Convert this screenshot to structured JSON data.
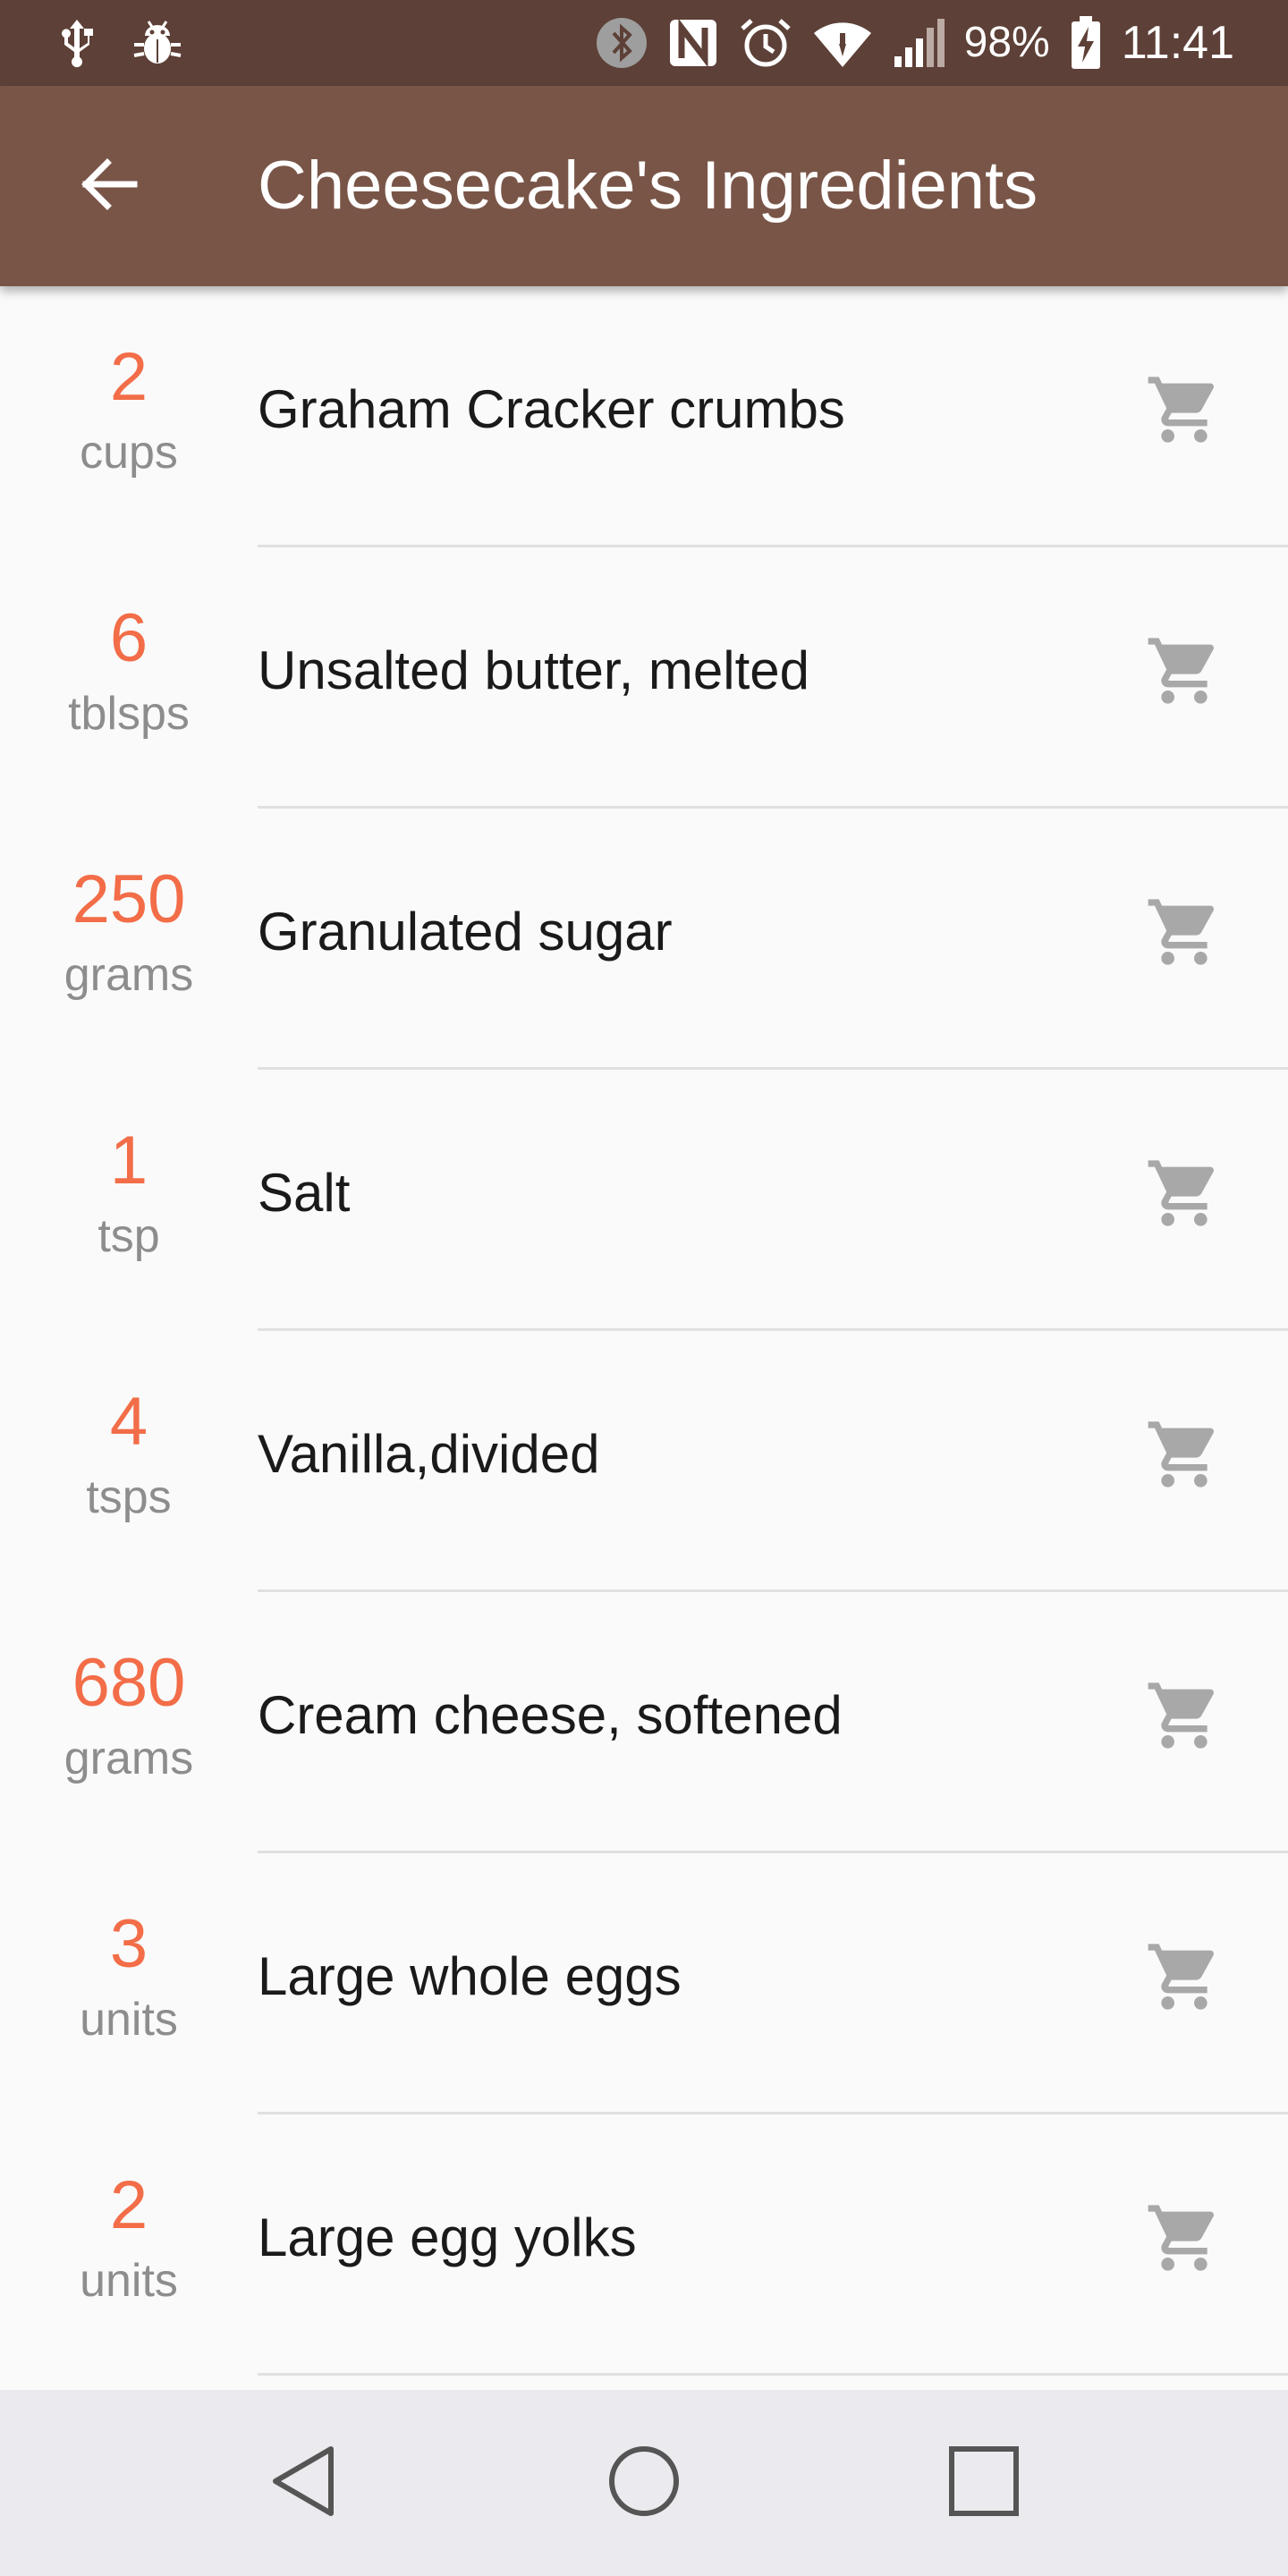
{
  "status_bar": {
    "battery_percent": "98%",
    "time": "11:41",
    "icons": [
      "usb-icon",
      "bug-icon",
      "bluetooth-icon",
      "nfc-icon",
      "alarm-icon",
      "wifi-icon",
      "signal-icon",
      "battery-charging-icon"
    ]
  },
  "app_bar": {
    "title": "Cheesecake's Ingredients",
    "back_icon": "arrow-back-icon"
  },
  "ingredients": [
    {
      "amount": "2",
      "unit": "cups",
      "name": "Graham Cracker crumbs"
    },
    {
      "amount": "6",
      "unit": "tblsps",
      "name": "Unsalted butter, melted"
    },
    {
      "amount": "250",
      "unit": "grams",
      "name": "Granulated sugar"
    },
    {
      "amount": "1",
      "unit": "tsp",
      "name": "Salt"
    },
    {
      "amount": "4",
      "unit": "tsps",
      "name": "Vanilla,divided"
    },
    {
      "amount": "680",
      "unit": "grams",
      "name": "Cream cheese, softened"
    },
    {
      "amount": "3",
      "unit": "units",
      "name": "Large whole eggs"
    },
    {
      "amount": "2",
      "unit": "units",
      "name": "Large egg yolks"
    }
  ],
  "row_icon": "cart-icon",
  "nav_bar": {
    "icons": [
      "nav-back-icon",
      "nav-home-icon",
      "nav-recents-icon"
    ]
  },
  "colors": {
    "status_bar": "#5d4037",
    "app_bar": "#795548",
    "amount": "#f26d48",
    "unit": "#8d8d8d",
    "cart_icon": "#a8a8a8"
  }
}
